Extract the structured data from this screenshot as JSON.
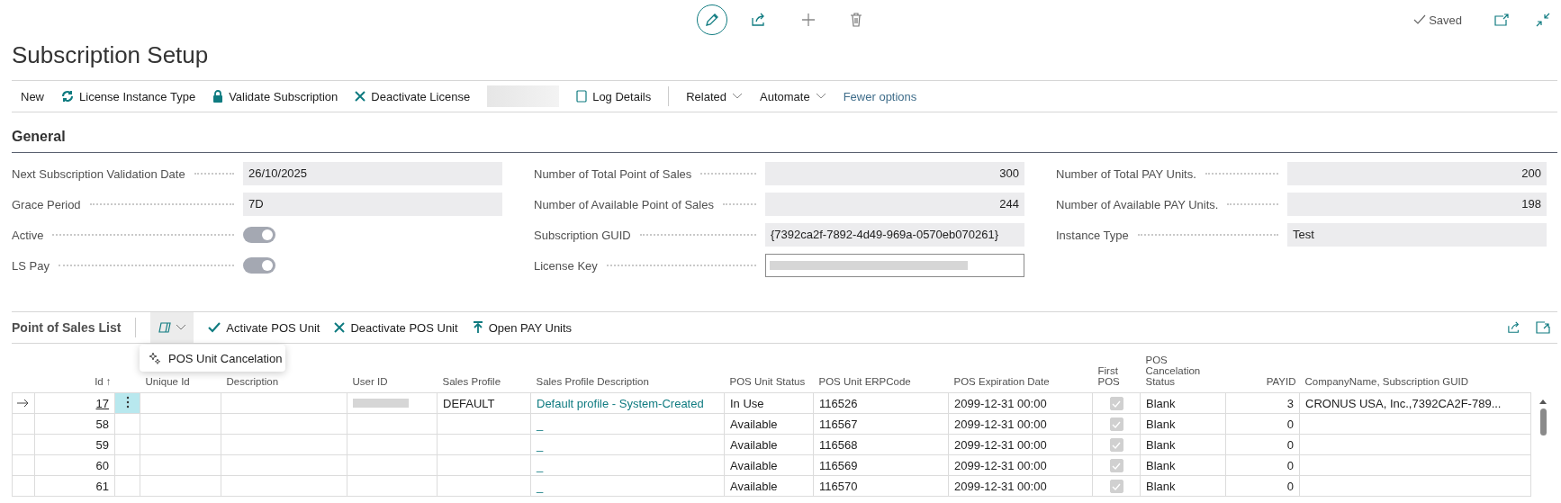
{
  "status": "Saved",
  "title": "Subscription Setup",
  "actions": [
    {
      "kind": "plain",
      "label": "New"
    },
    {
      "kind": "refresh",
      "label": "License Instance Type"
    },
    {
      "kind": "lock",
      "label": "Validate Subscription"
    },
    {
      "kind": "cross",
      "label": "Deactivate License"
    },
    {
      "kind": "redacted"
    },
    {
      "kind": "log",
      "label": "Log Details"
    },
    {
      "kind": "divider"
    },
    {
      "kind": "menu",
      "label": "Related"
    },
    {
      "kind": "menu",
      "label": "Automate"
    },
    {
      "kind": "link",
      "label": "Fewer options"
    }
  ],
  "general": {
    "title": "General",
    "columns": [
      [
        {
          "kind": "text",
          "label": "Next Subscription Validation Date",
          "value": "26/10/2025"
        },
        {
          "kind": "text",
          "label": "Grace Period",
          "value": "7D"
        },
        {
          "kind": "toggle",
          "label": "Active",
          "on": true
        },
        {
          "kind": "toggle",
          "label": "LS Pay",
          "on": true
        }
      ],
      [
        {
          "kind": "number",
          "label": "Number of Total Point of Sales",
          "value": "300"
        },
        {
          "kind": "number",
          "label": "Number of Available Point of Sales",
          "value": "244"
        },
        {
          "kind": "text",
          "label": "Subscription GUID",
          "value": "{7392ca2f-7892-4d49-969a-0570eb070261}"
        },
        {
          "kind": "redacted",
          "label": "License Key"
        }
      ],
      [
        {
          "kind": "number",
          "label": "Number of Total PAY Units.",
          "value": "200"
        },
        {
          "kind": "number",
          "label": "Number of Available PAY Units.",
          "value": "198"
        },
        {
          "kind": "text",
          "label": "Instance Type",
          "value": "Test"
        }
      ]
    ]
  },
  "list": {
    "title": "Point of Sales List",
    "menu_expanded": true,
    "actions": [
      {
        "kind": "check",
        "label": "Activate POS Unit"
      },
      {
        "kind": "cross",
        "label": "Deactivate POS Unit"
      },
      {
        "kind": "upload",
        "label": "Open PAY Units"
      }
    ],
    "menu_items": [
      {
        "label": "POS Unit Cancelation"
      }
    ],
    "columns": [
      {
        "label": "Id",
        "sort_icon": "↑"
      },
      {
        "label": "Unique Id"
      },
      {
        "label": "Description"
      },
      {
        "label": "User ID"
      },
      {
        "label": "Sales Profile"
      },
      {
        "label": "Sales Profile Description"
      },
      {
        "label": "POS Unit Status"
      },
      {
        "label": "POS Unit ERPCode"
      },
      {
        "label": "POS Expiration Date"
      },
      {
        "label": "First POS"
      },
      {
        "label": "POS Cancelation Status"
      },
      {
        "label": "PAYID"
      },
      {
        "label": "CompanyName, Subscription GUID"
      }
    ],
    "rows": [
      {
        "selected": true,
        "id": "17",
        "user_redacted": true,
        "sales_profile": "DEFAULT",
        "sales_profile_description": "Default profile - System-Created",
        "status": "In Use",
        "erp_code": "116526",
        "expiration": "2099-12-31 00:00",
        "first_pos": true,
        "cancelation_status": "Blank",
        "payid": "3",
        "company": "CRONUS USA, Inc.,7392CA2F-789..."
      },
      {
        "selected": false,
        "id": "58",
        "user_redacted": false,
        "sales_profile_description": "_",
        "status": "Available",
        "erp_code": "116567",
        "expiration": "2099-12-31 00:00",
        "first_pos": true,
        "cancelation_status": "Blank",
        "payid": "0"
      },
      {
        "selected": false,
        "id": "59",
        "user_redacted": false,
        "sales_profile_description": "_",
        "status": "Available",
        "erp_code": "116568",
        "expiration": "2099-12-31 00:00",
        "first_pos": true,
        "cancelation_status": "Blank",
        "payid": "0"
      },
      {
        "selected": false,
        "id": "60",
        "user_redacted": false,
        "sales_profile_description": "_",
        "status": "Available",
        "erp_code": "116569",
        "expiration": "2099-12-31 00:00",
        "first_pos": true,
        "cancelation_status": "Blank",
        "payid": "0"
      },
      {
        "selected": false,
        "id": "61",
        "user_redacted": false,
        "sales_profile_description": "_",
        "status": "Available",
        "erp_code": "116570",
        "expiration": "2099-12-31 00:00",
        "first_pos": true,
        "cancelation_status": "Blank",
        "payid": "0"
      }
    ]
  }
}
